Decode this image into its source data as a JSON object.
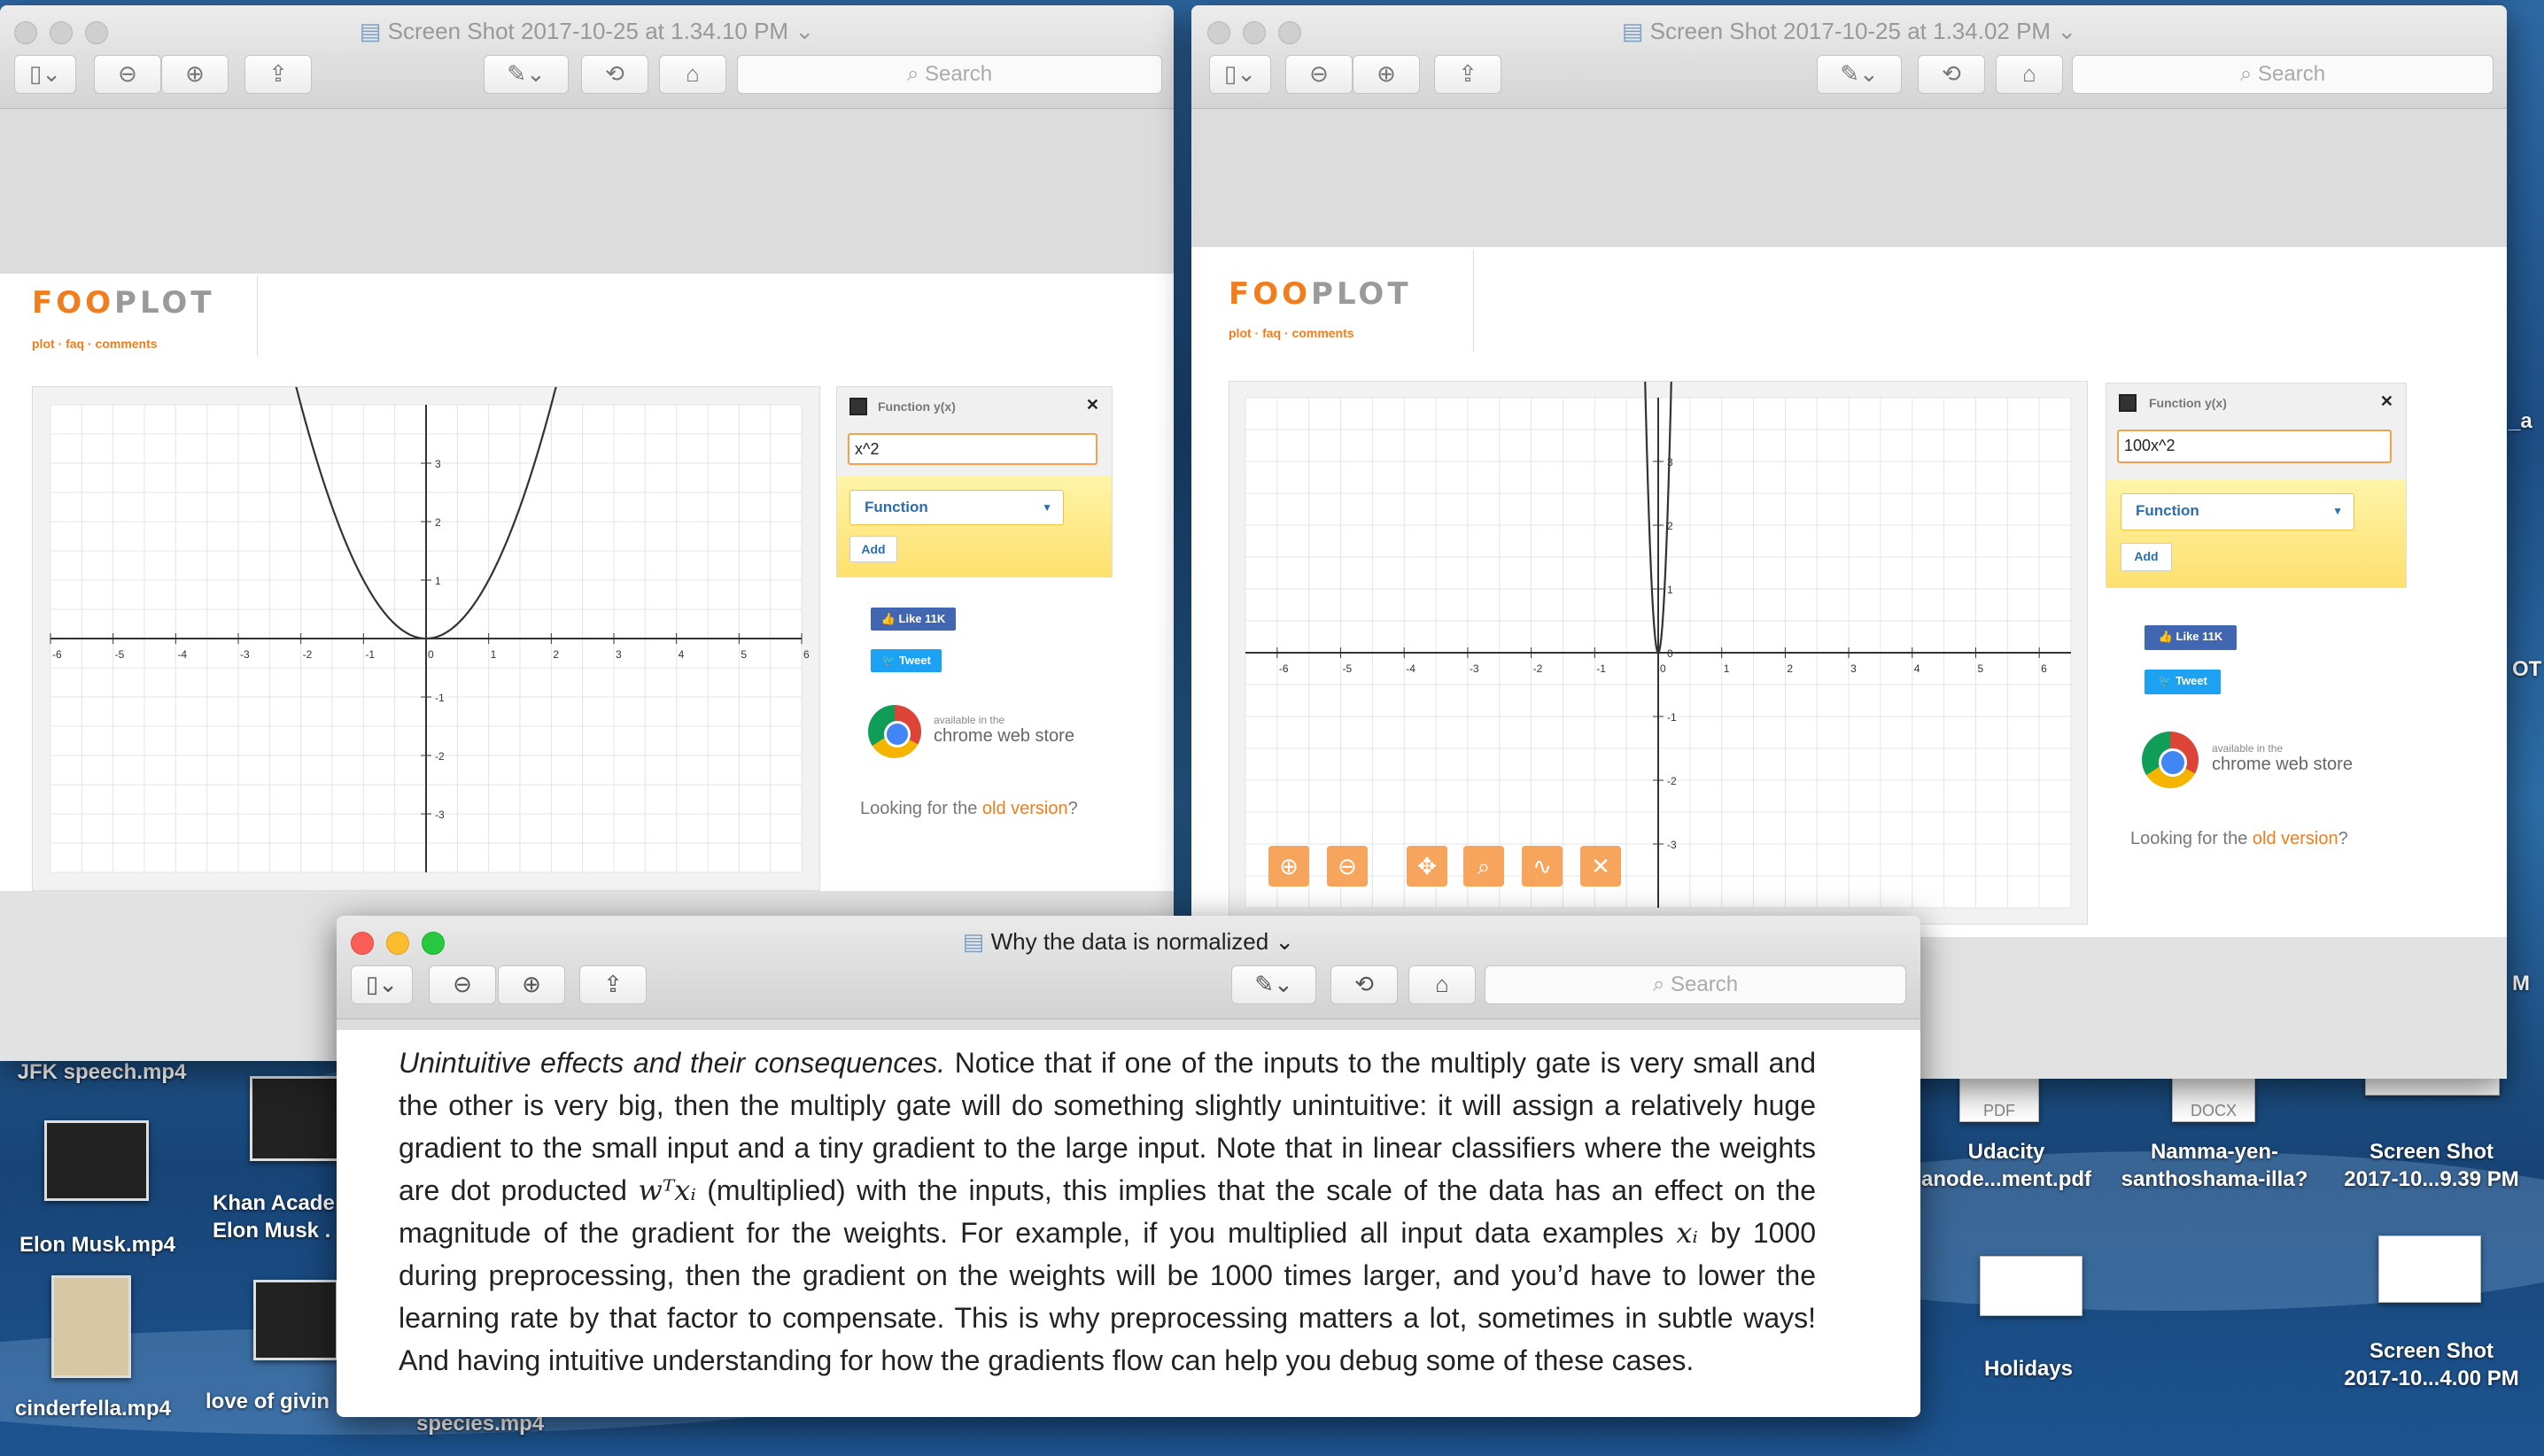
{
  "desktop": {
    "icons": [
      {
        "id": "jfk",
        "label": "JFK speech.mp4"
      },
      {
        "id": "elon",
        "label": "Elon Musk.mp4"
      },
      {
        "id": "khan",
        "label": "Khan Acade\nElon Musk ."
      },
      {
        "id": "cinder",
        "label": "cinderfella.mp4"
      },
      {
        "id": "love",
        "label": "love of givin"
      },
      {
        "id": "species",
        "label": "species.mp4"
      },
      {
        "id": "udacity",
        "label": "Udacity\nanode...ment.pdf",
        "badge": "PDF"
      },
      {
        "id": "namma",
        "label": "Namma-yen-\nsanthoshama-illa?",
        "badge": "DOCX"
      },
      {
        "id": "ss1",
        "label": "Screen Shot\n2017-10...9.39 PM"
      },
      {
        "id": "holidays",
        "label": "Holidays"
      },
      {
        "id": "ss2",
        "label": "Screen Shot\n2017-10...4.00 PM"
      }
    ],
    "edge_fragments": [
      "_a",
      "OT",
      "M"
    ]
  },
  "window_left": {
    "title": "Screen Shot 2017-10-25 at 1.34.10 PM",
    "search_placeholder": "Search",
    "function_label": "Function y(x)",
    "function_value": "x^2",
    "select_value": "Function",
    "add_label": "Add"
  },
  "window_right": {
    "title": "Screen Shot 2017-10-25 at 1.34.02 PM",
    "search_placeholder": "Search",
    "function_label": "Function y(x)",
    "function_value": "100x^2",
    "select_value": "Function",
    "add_label": "Add"
  },
  "fooplot": {
    "logo_a": "FOO",
    "logo_b": "PLOT",
    "links": "plot · faq · comments",
    "like_label": "Like 11K",
    "tweet_label": "Tweet",
    "cws_small": "available in the",
    "cws_big": "chrome web store",
    "old_prefix": "Looking for the ",
    "old_link": "old version",
    "old_suffix": "?"
  },
  "window_doc": {
    "title": "Why the data is normalized",
    "search_placeholder": "Search",
    "para_italic": "Unintuitive effects and their consequences.",
    "para_1": " Notice that if one of the inputs to the multiply gate is very small and the other is very big, then the multiply gate will do something slightly unintuitive: it will assign a relatively huge gradient to the small input and a tiny gradient to the large input. Note that in linear classifiers where the weights are dot producted ",
    "math_1": "wᵀxᵢ",
    "para_2": " (multiplied) with the inputs, this implies that the scale of the data has an effect on the magnitude of the gradient for the weights. For example, if you multiplied all input data examples ",
    "math_2": "xᵢ",
    "para_3": " by 1000 during preprocessing, then the gradient on the weights will be 1000 times larger, and you’d have to lower the learning rate by that factor to compensate. This is why preprocessing matters a lot, sometimes in subtle ways! And having intuitive understanding for how the gradients flow can help you debug some of these cases."
  },
  "colors": {
    "accent": "#f07d1e",
    "fooplot_yellow": "#fde06e",
    "facebook": "#4267b2",
    "twitter": "#1da1f2"
  },
  "chart_data": [
    {
      "type": "line",
      "series": [
        {
          "values": "y = x^2"
        }
      ],
      "xlim": [
        -6,
        6
      ],
      "ylim": [
        -4,
        4
      ],
      "x_ticks": [
        -6,
        -5,
        -4,
        -3,
        -2,
        -1,
        0,
        1,
        2,
        3,
        4,
        5,
        6
      ],
      "y_ticks": [
        -3,
        -2,
        -1,
        1,
        2,
        3
      ],
      "grid": true
    },
    {
      "type": "line",
      "series": [
        {
          "values": "y = 100x^2"
        }
      ],
      "xlim": [
        -6.5,
        6.5
      ],
      "ylim": [
        -4,
        4
      ],
      "x_ticks": [
        -6,
        -5,
        -4,
        -3,
        -2,
        -1,
        0,
        1,
        2,
        3,
        4,
        5,
        6
      ],
      "y_ticks": [
        -3,
        -2,
        -1,
        0,
        1,
        2,
        3
      ],
      "grid": true
    }
  ]
}
